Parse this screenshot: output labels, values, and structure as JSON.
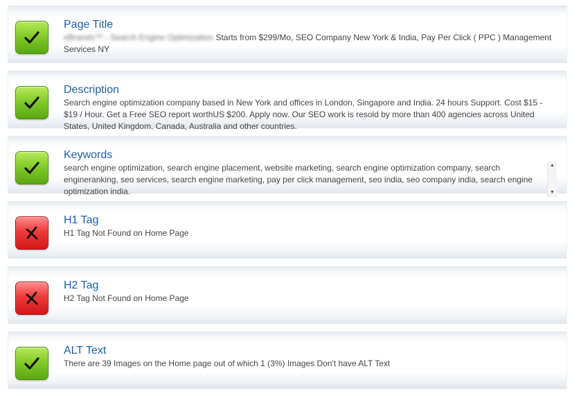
{
  "checks": [
    {
      "status": "pass",
      "title": "Page Title",
      "blurred_text": "eBrands™ - Search Engine Optimization",
      "text": "Starts from $299/Mo, SEO Company New York & India, Pay Per Click ( PPC ) Management Services NY"
    },
    {
      "status": "pass",
      "title": "Description",
      "text": "Search engine optimization company based in New York and offices in London, Singapore and India. 24 hours Support. Cost $15 - $19 / Hour. Get a Free SEO report worthUS $200. Apply now. Our SEO work is resold by more than 400 agencies across United States, United Kingdom, Canada, Australia and other countries."
    },
    {
      "status": "pass",
      "title": "Keywords",
      "text": "search engine optimization, search engine placement, website marketing, search engine optimization company, search engineranking, seo services, search engine marketing, pay per click management, seo india, seo company india, search engine optimization india."
    },
    {
      "status": "fail",
      "title": "H1 Tag",
      "text": "H1 Tag Not Found on Home Page"
    },
    {
      "status": "fail",
      "title": "H2 Tag",
      "text": "H2 Tag Not Found on Home Page"
    },
    {
      "status": "pass",
      "title": "ALT Text",
      "text": "There are 39 Images on the Home page out of which 1 (3%) Images Don't have ALT Text"
    }
  ],
  "scrollbar": {
    "up_glyph": "▲",
    "down_glyph": "▼"
  },
  "icons": {
    "pass": "check-icon",
    "fail": "cross-icon"
  },
  "colors": {
    "pass": "#6cbd1e",
    "fail": "#e52a2a",
    "title": "#1d5fa4",
    "text": "#444444"
  }
}
